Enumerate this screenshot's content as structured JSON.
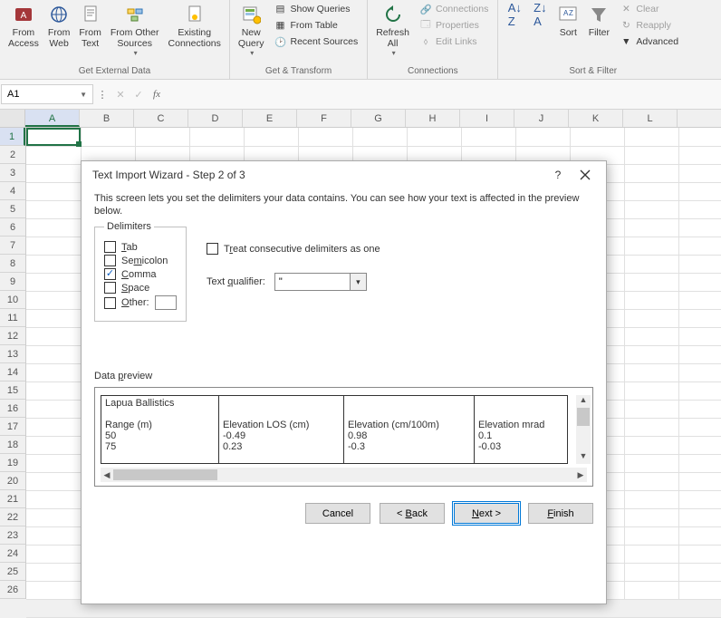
{
  "ribbon": {
    "groups": {
      "getext": {
        "label": "Get External Data",
        "access": "From\nAccess",
        "web": "From\nWeb",
        "text": "From\nText",
        "other": "From Other\nSources",
        "existing": "Existing\nConnections"
      },
      "gettrans": {
        "label": "Get & Transform",
        "newq": "New\nQuery",
        "show": "Show Queries",
        "table": "From Table",
        "recent": "Recent Sources"
      },
      "conn": {
        "label": "Connections",
        "refresh": "Refresh\nAll",
        "connections": "Connections",
        "properties": "Properties",
        "edit": "Edit Links"
      },
      "sortfilt": {
        "label": "Sort & Filter",
        "sort": "Sort",
        "filter": "Filter",
        "clear": "Clear",
        "reapply": "Reapply",
        "advanced": "Advanced"
      }
    }
  },
  "namebox": "A1",
  "columns": [
    "A",
    "B",
    "C",
    "D",
    "E",
    "F",
    "G",
    "H",
    "I",
    "J",
    "K",
    "L"
  ],
  "rows": [
    "1",
    "2",
    "3",
    "4",
    "5",
    "6",
    "7",
    "8",
    "9",
    "10",
    "11",
    "12",
    "13",
    "14",
    "15",
    "16",
    "17",
    "18",
    "19",
    "20",
    "21",
    "22",
    "23",
    "24",
    "25",
    "26"
  ],
  "dialog": {
    "title": "Text Import Wizard - Step 2 of 3",
    "instruction": "This screen lets you set the delimiters your data contains.  You can see how your text is affected in the preview below.",
    "delimiters_legend": "Delimiters",
    "tab": "Tab",
    "semicolon": "Semicolon",
    "comma": "Comma",
    "space": "Space",
    "other": "Other:",
    "treat": "Treat consecutive delimiters as one",
    "qualifier_label": "Text qualifier:",
    "qualifier_value": "\"",
    "preview_label": "Data preview",
    "preview": {
      "col1": "Lapua Ballistics\n\nRange (m)\n50\n75",
      "col2": "\n\nElevation LOS (cm)\n-0.49\n0.23",
      "col3": "\n\nElevation (cm/100m)\n0.98\n-0.3",
      "col4": "\n\nElevation mrad\n0.1\n-0.03"
    },
    "buttons": {
      "cancel": "Cancel",
      "back": "< Back",
      "next": "Next >",
      "finish": "Finish"
    }
  }
}
